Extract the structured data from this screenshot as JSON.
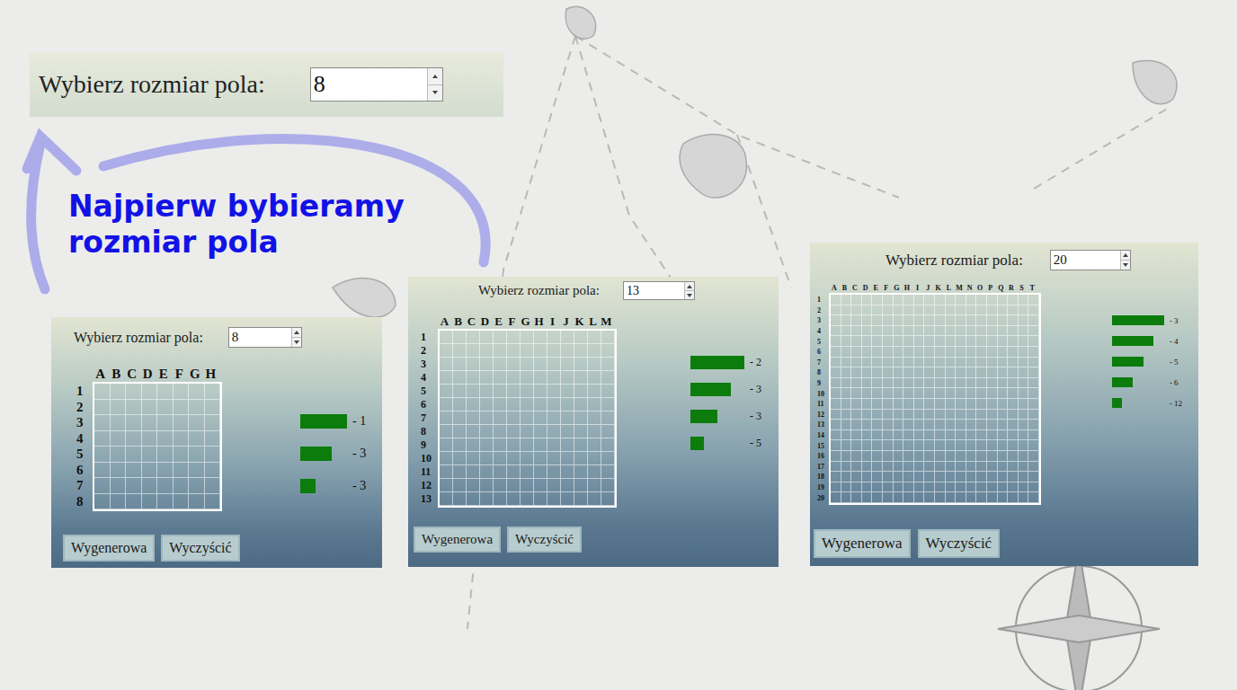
{
  "banner": {
    "label": "Wybierz rozmiar pola:",
    "value": "8"
  },
  "note": {
    "lines": [
      "Najpierw bybieramy",
      "rozmiar pola"
    ]
  },
  "panels": [
    {
      "label": "Wybierz rozmiar pola:",
      "value": "8",
      "columns": [
        "A",
        "B",
        "C",
        "D",
        "E",
        "F",
        "G",
        "H"
      ],
      "rows": [
        "1",
        "2",
        "3",
        "4",
        "5",
        "6",
        "7",
        "8"
      ],
      "ships": [
        {
          "count": "- 1",
          "level": 1
        },
        {
          "count": "- 3",
          "level": 0.667
        },
        {
          "count": "- 3",
          "level": 0.333
        }
      ],
      "buttons": [
        "Wygenerowa",
        "Wyczyścić"
      ]
    },
    {
      "label": "Wybierz rozmiar pola:",
      "value": "13",
      "columns": [
        "A",
        "B",
        "C",
        "D",
        "E",
        "F",
        "G",
        "H",
        "I",
        "J",
        "K",
        "L",
        "M"
      ],
      "rows": [
        "1",
        "2",
        "3",
        "4",
        "5",
        "6",
        "7",
        "8",
        "9",
        "10",
        "11",
        "12",
        "13"
      ],
      "ships": [
        {
          "count": "- 2",
          "level": 1
        },
        {
          "count": "- 3",
          "level": 0.75
        },
        {
          "count": "- 3",
          "level": 0.5
        },
        {
          "count": "- 5",
          "level": 0.25
        }
      ],
      "buttons": [
        "Wygenerowa",
        "Wyczyścić"
      ]
    },
    {
      "label": "Wybierz rozmiar pola:",
      "value": "20",
      "columns": [
        "A",
        "B",
        "C",
        "D",
        "E",
        "F",
        "G",
        "H",
        "I",
        "J",
        "K",
        "L",
        "M",
        "N",
        "O",
        "P",
        "Q",
        "R",
        "S",
        "T"
      ],
      "rows": [
        "1",
        "2",
        "3",
        "4",
        "5",
        "6",
        "7",
        "8",
        "9",
        "10",
        "11",
        "12",
        "13",
        "14",
        "15",
        "16",
        "17",
        "18",
        "19",
        "20"
      ],
      "ships": [
        {
          "count": "- 3",
          "level": 1
        },
        {
          "count": "- 4",
          "level": 0.8
        },
        {
          "count": "- 5",
          "level": 0.6
        },
        {
          "count": "- 6",
          "level": 0.4
        },
        {
          "count": "- 12",
          "level": 0.2
        }
      ],
      "buttons": [
        "Wygenerowa",
        "Wyczyścić"
      ]
    }
  ]
}
